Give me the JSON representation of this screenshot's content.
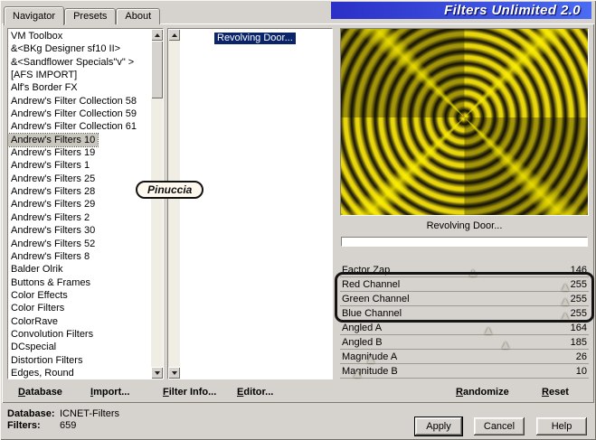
{
  "window": {
    "title": "Filters Unlimited 2.0"
  },
  "tabs": [
    {
      "label": "Navigator",
      "active": true
    },
    {
      "label": "Presets",
      "active": false
    },
    {
      "label": "About",
      "active": false
    }
  ],
  "category_list": {
    "items": [
      "VM Toolbox",
      "&<BKg Designer sf10 II>",
      "&<Sandflower Specials\"v\" >",
      "[AFS IMPORT]",
      "Alf's Border FX",
      "Andrew's Filter Collection 58",
      "Andrew's Filter Collection 59",
      "Andrew's Filter Collection 61",
      "Andrew's Filters 10",
      "Andrew's Filters 19",
      "Andrew's Filters 1",
      "Andrew's Filters 25",
      "Andrew's Filters 28",
      "Andrew's Filters 29",
      "Andrew's Filters 2",
      "Andrew's Filters 30",
      "Andrew's Filters 52",
      "Andrew's Filters 8",
      "Balder Olrik",
      "Buttons & Frames",
      "Color Effects",
      "Color Filters",
      "ColorRave",
      "Convolution Filters",
      "DCspecial",
      "Distortion Filters",
      "Edges, Round"
    ],
    "selected": "Andrew's Filters 10"
  },
  "filter_list": {
    "items": [
      "Revolving Door..."
    ],
    "selected": "Revolving Door..."
  },
  "watermark": "Pinuccia",
  "preview": {
    "caption": "Revolving Door..."
  },
  "sliders": [
    {
      "label": "Factor Zap",
      "value": 146,
      "max": 255,
      "highlight": false
    },
    {
      "label": "Red Channel",
      "value": 255,
      "max": 255,
      "highlight": true
    },
    {
      "label": "Green Channel",
      "value": 255,
      "max": 255,
      "highlight": true
    },
    {
      "label": "Blue Channel",
      "value": 255,
      "max": 255,
      "highlight": true
    },
    {
      "label": "Angled A",
      "value": 164,
      "max": 255,
      "highlight": false
    },
    {
      "label": "Angled B",
      "value": 185,
      "max": 255,
      "highlight": false
    },
    {
      "label": "Magnitude A",
      "value": 26,
      "max": 255,
      "highlight": false
    },
    {
      "label": "Magnitude B",
      "value": 10,
      "max": 255,
      "highlight": false
    }
  ],
  "toolbar": {
    "database": "Database",
    "import": "Import...",
    "filter_info": "Filter Info...",
    "editor": "Editor...",
    "randomize": "Randomize",
    "reset": "Reset"
  },
  "status": {
    "database_label": "Database:",
    "database_value": "ICNET-Filters",
    "filters_label": "Filters:",
    "filters_value": "659"
  },
  "actions": {
    "apply": "Apply",
    "cancel": "Cancel",
    "help": "Help"
  },
  "colors": {
    "selection_blue": "#0a246a",
    "title_blue_left": "#2b2fc6",
    "title_blue_right": "#4a6cf2",
    "preview_yellow": "#e9d70b",
    "annotation_outline": "#141414"
  }
}
